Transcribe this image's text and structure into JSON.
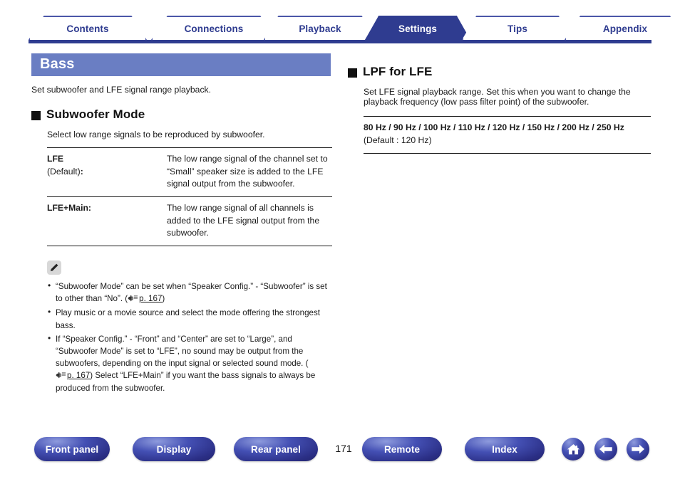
{
  "tabs": [
    {
      "label": "Contents",
      "active": false
    },
    {
      "label": "Connections",
      "active": false
    },
    {
      "label": "Playback",
      "active": false
    },
    {
      "label": "Settings",
      "active": true
    },
    {
      "label": "Tips",
      "active": false
    },
    {
      "label": "Appendix",
      "active": false
    }
  ],
  "left": {
    "title": "Bass",
    "intro": "Set subwoofer and LFE signal range playback.",
    "section": {
      "heading": "Subwoofer Mode",
      "subtitle": "Select low range signals to be reproduced by subwoofer.",
      "rows": [
        {
          "term": "LFE",
          "term_note": "(Default)",
          "colon": ":",
          "desc": "The low range signal of the channel set to “Small” speaker size is added to the LFE signal output from the subwoofer."
        },
        {
          "term": "LFE+Main:",
          "term_note": "",
          "colon": "",
          "desc": "The low range signal of all channels is added to the LFE signal output from the subwoofer."
        }
      ]
    },
    "note": {
      "icon": "pencil-icon",
      "items": [
        {
          "text_before": "“Subwoofer Mode” can be set when “Speaker Config.” - “Subwoofer” is set to other than “No”.  (",
          "page_ref": "p. 167",
          "text_after": ")"
        },
        {
          "text_before": "Play music or a movie source and select the mode offering the strongest bass.",
          "page_ref": "",
          "text_after": ""
        },
        {
          "text_before": "If “Speaker Config.” - “Front” and “Center” are set to “Large”, and “Subwoofer Mode” is set to “LFE”, no sound may be output from the subwoofers, depending on the input signal or selected sound mode.  (",
          "page_ref": "p. 167",
          "text_after": ") Select “LFE+Main” if you want the bass signals to always be produced from the subwoofer."
        }
      ]
    }
  },
  "right": {
    "section": {
      "heading": "LPF for LFE",
      "subtitle": "Set LFE signal playback range. Set this when you want to change the playback frequency (low pass filter point) of the subwoofer.",
      "values": "80 Hz / 90 Hz / 100 Hz / 110 Hz / 120 Hz / 150 Hz / 200 Hz / 250 Hz",
      "default": "(Default : 120 Hz)"
    }
  },
  "footer": {
    "buttons": [
      {
        "label": "Front panel"
      },
      {
        "label": "Display"
      },
      {
        "label": "Rear panel"
      },
      {
        "label": "Remote"
      },
      {
        "label": "Index"
      }
    ],
    "page_number": "171",
    "icons": [
      {
        "name": "home-icon"
      },
      {
        "name": "back-arrow-icon"
      },
      {
        "name": "forward-arrow-icon"
      }
    ]
  },
  "colors": {
    "tab_border": "#4b57a8",
    "tab_active_bg": "#2f3c90",
    "title_bar_bg": "#6a7ec3",
    "rule": "#2f3c90"
  }
}
